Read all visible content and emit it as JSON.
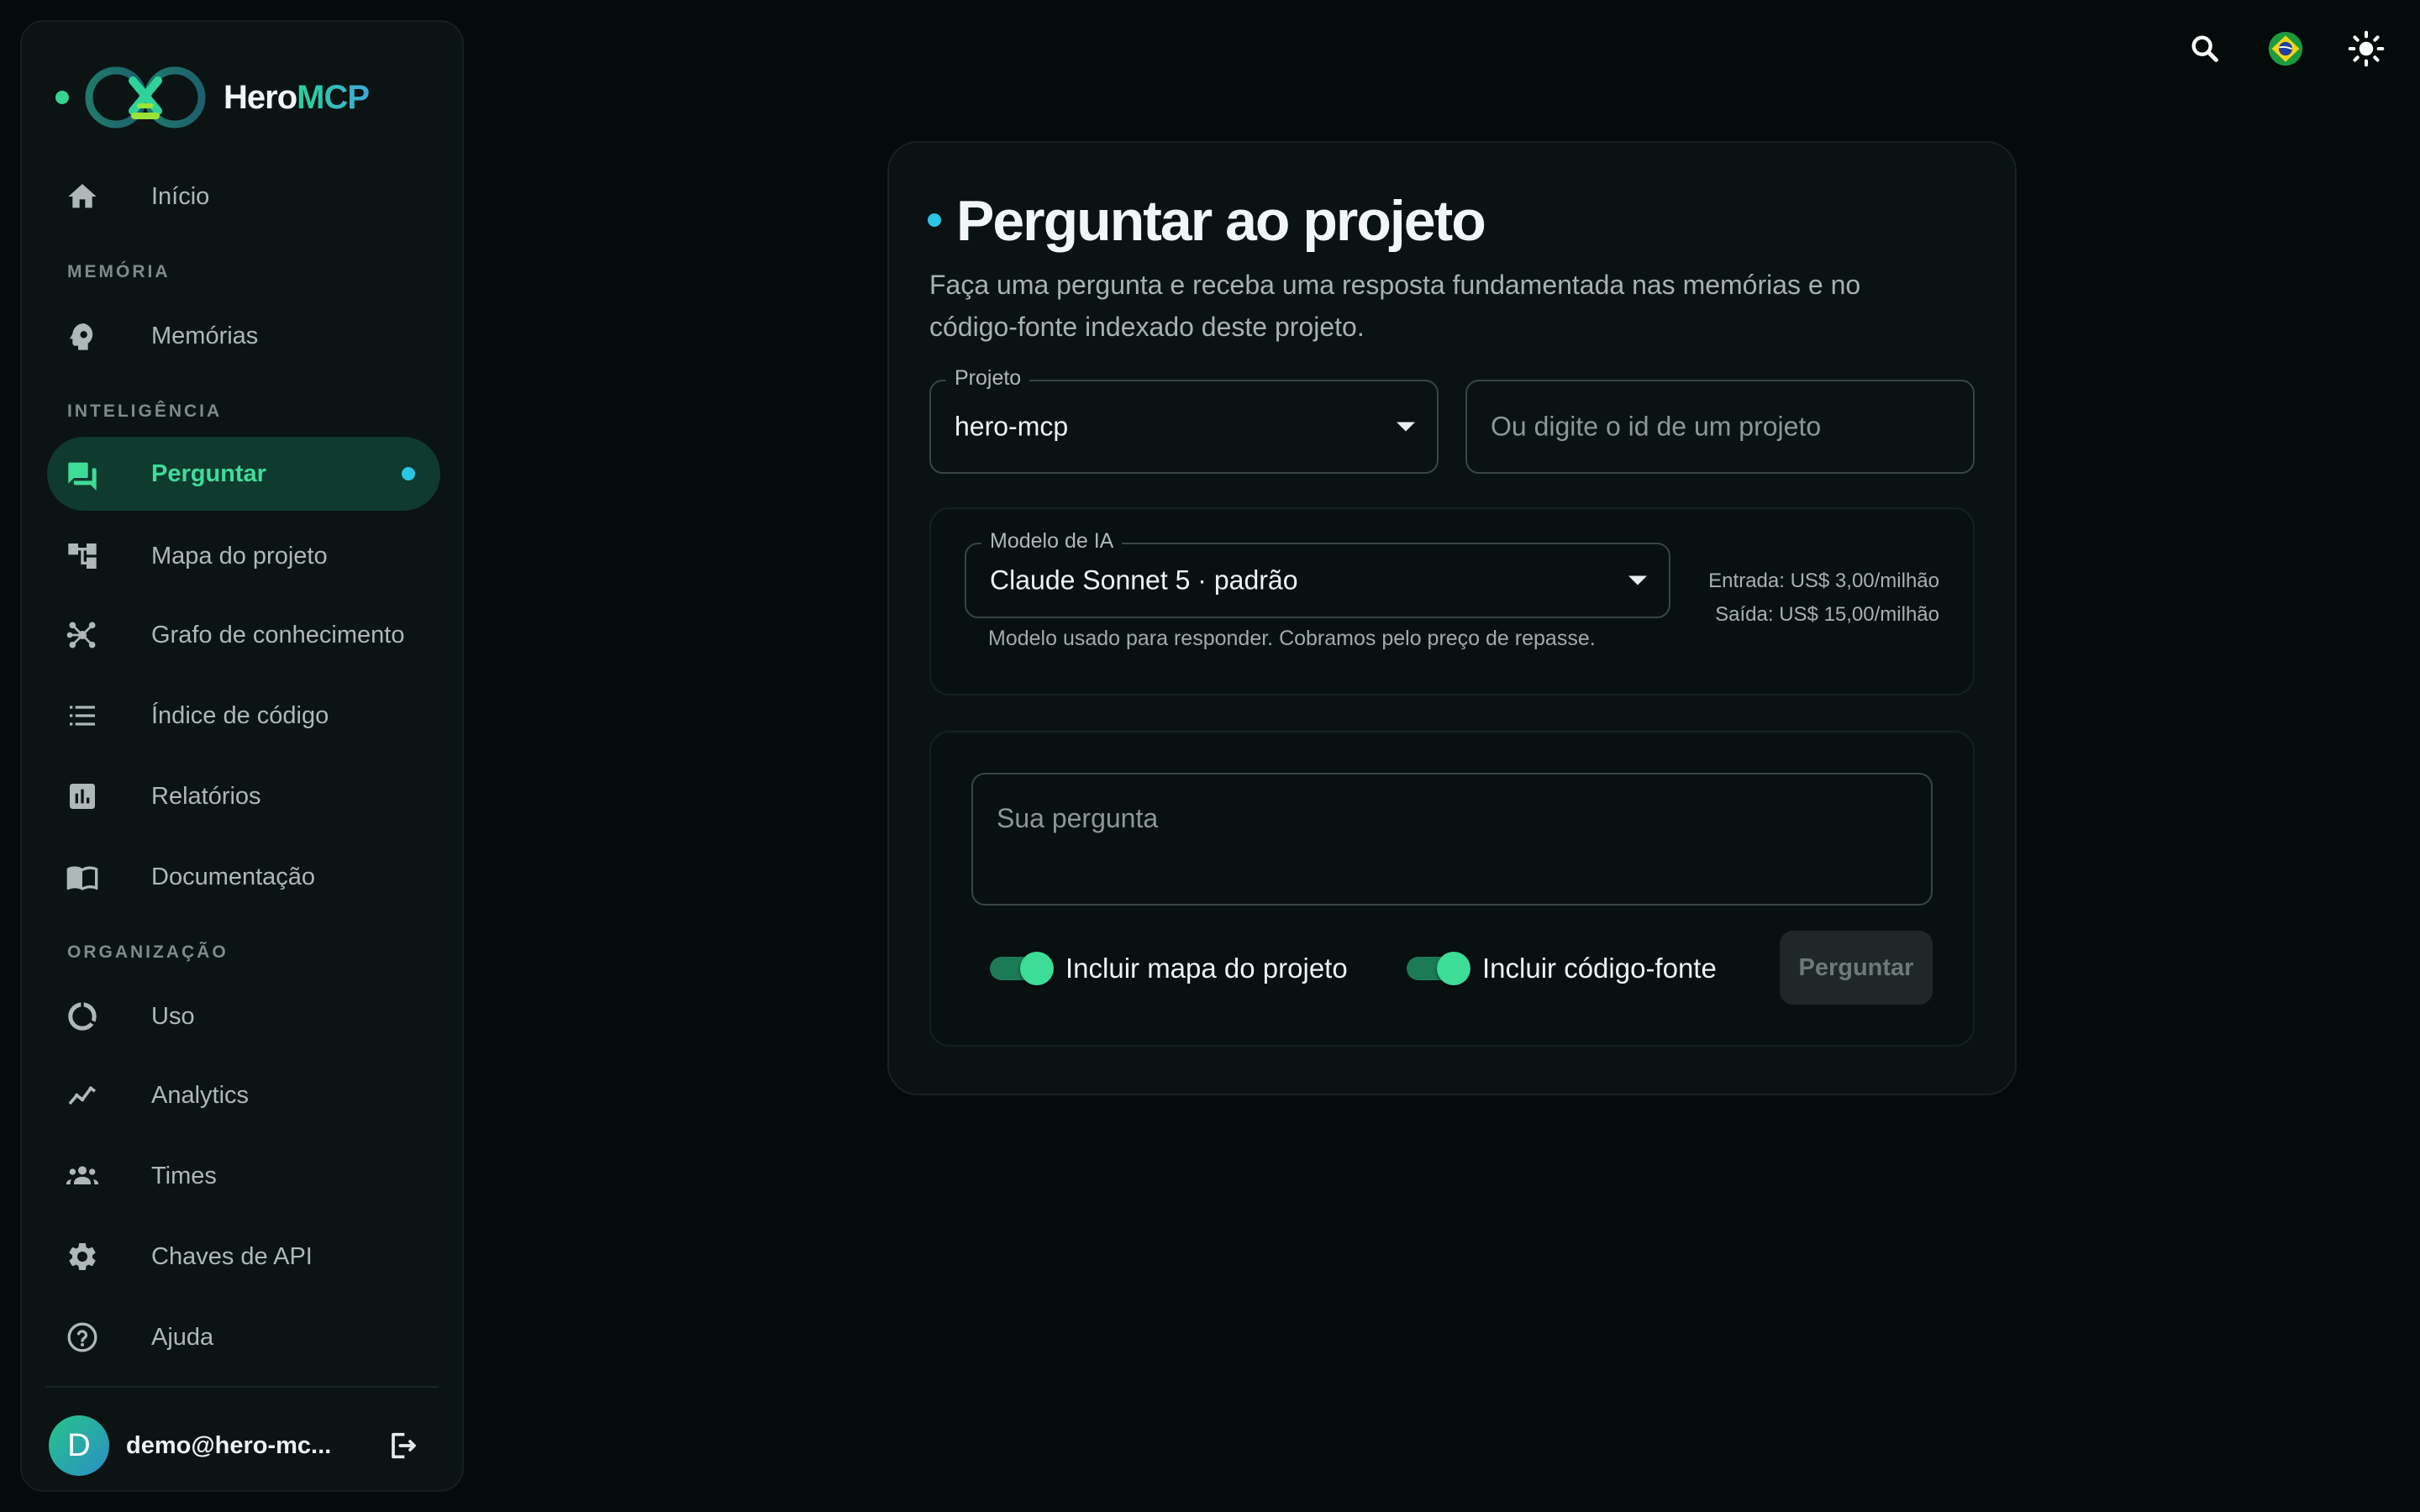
{
  "brand": {
    "name_part1": "Hero",
    "name_part2": "MCP"
  },
  "sidebar": {
    "items": [
      {
        "label": "Início",
        "icon": "home-icon"
      },
      {
        "label": "Memórias",
        "icon": "brain-icon"
      },
      {
        "label": "Perguntar",
        "icon": "chat-icon",
        "active": true
      },
      {
        "label": "Mapa do projeto",
        "icon": "tree-icon"
      },
      {
        "label": "Grafo de conhecimento",
        "icon": "graph-icon"
      },
      {
        "label": "Índice de código",
        "icon": "list-icon"
      },
      {
        "label": "Relatórios",
        "icon": "bar-chart-icon"
      },
      {
        "label": "Documentação",
        "icon": "book-icon"
      },
      {
        "label": "Uso",
        "icon": "donut-icon"
      },
      {
        "label": "Analytics",
        "icon": "trend-icon"
      },
      {
        "label": "Times",
        "icon": "group-icon"
      },
      {
        "label": "Chaves de API",
        "icon": "gear-icon"
      },
      {
        "label": "Ajuda",
        "icon": "help-icon"
      }
    ],
    "sections": {
      "memory": "MEMÓRIA",
      "intelligence": "INTELIGÊNCIA",
      "organization": "ORGANIZAÇÃO"
    },
    "user": {
      "initial": "D",
      "email": "demo@hero-mc..."
    }
  },
  "topbar": {
    "icons": [
      "search-icon",
      "brazil-flag-icon",
      "sun-icon"
    ]
  },
  "main": {
    "title": "Perguntar ao projeto",
    "subtitle": "Faça uma pergunta e receba uma resposta fundamentada nas memórias e no código-fonte indexado deste projeto.",
    "project": {
      "label": "Projeto",
      "value": "hero-mcp"
    },
    "project_id_placeholder": "Ou digite o id de um projeto",
    "model": {
      "label": "Modelo de IA",
      "value": "Claude Sonnet 5 · padrão",
      "helper": "Modelo usado para responder. Cobramos pelo preço de repasse.",
      "price_in": "Entrada: US$ 3,00/milhão",
      "price_out": "Saída: US$ 15,00/milhão"
    },
    "question_placeholder": "Sua pergunta",
    "toggle_map": {
      "label": "Incluir mapa do projeto",
      "on": true
    },
    "toggle_source": {
      "label": "Incluir código-fonte",
      "on": true
    },
    "submit_label": "Perguntar"
  },
  "colors": {
    "accent": "#3ddc97",
    "accent_dark": "#0f3a2e",
    "dot": "#29c6e6",
    "background": "#050a0a"
  }
}
